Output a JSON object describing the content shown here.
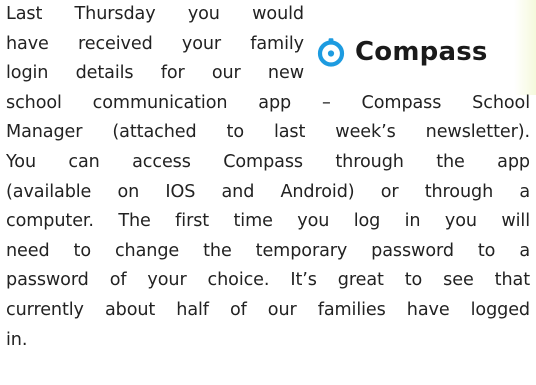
{
  "logo": {
    "text": "Compass",
    "icon": "compass-logo-icon",
    "accent_color": "#1d9be0"
  },
  "article": {
    "lines": [
      "Last Thursday you would",
      "have received your family",
      "login details for our new",
      "school communication app – Compass School",
      "Manager (attached to last week’s newsletter).",
      "You can access Compass through the app",
      "(available on IOS and Android) or through a",
      "computer. The first time you log in you will",
      "need to change the temporary password to a",
      "password of your choice. It’s great to see that",
      "currently about half of our families have logged",
      "in."
    ]
  }
}
